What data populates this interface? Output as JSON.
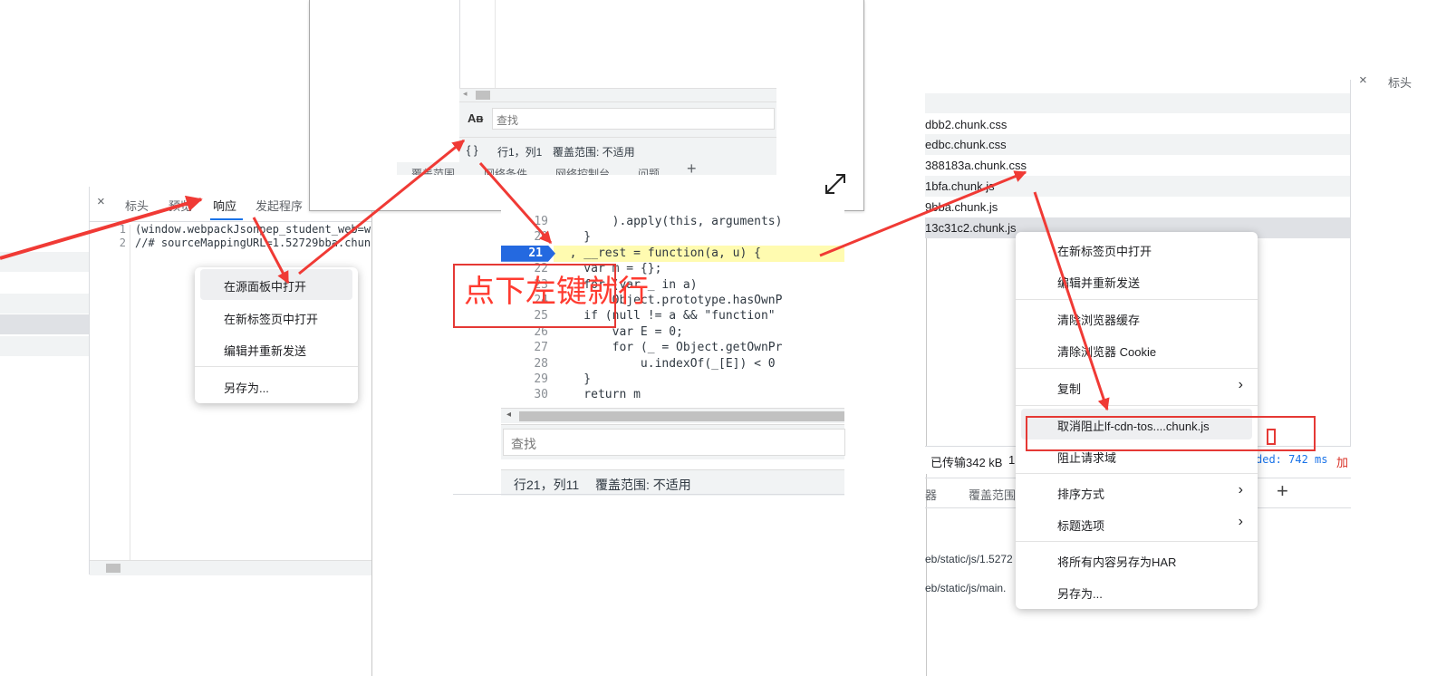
{
  "left_panel": {
    "tabs": [
      "标头",
      "预览",
      "响应",
      "发起程序"
    ],
    "close_icon": "×",
    "gutter": [
      "1",
      "2"
    ],
    "code_lines": [
      "(window.webpackJsonpep_student_web=wi",
      "//# sourceMappingURL=1.52729bba.chunk"
    ]
  },
  "context_menu_1": {
    "items": [
      "在源面板中打开",
      "在新标签页中打开",
      "编辑并重新发送",
      "另存为..."
    ]
  },
  "popup": {
    "find_icon": "Aᴃ",
    "find_placeholder": "查找",
    "format_icon": "{ }",
    "status_pos": "行1，列1",
    "status_coverage": "覆盖范围: 不适用",
    "bottom_tabs": [
      "覆盖范围",
      "网络条件",
      "网络控制台",
      "问题"
    ],
    "add_icon": "+"
  },
  "code_editor": {
    "lines": [
      {
        "num": "19",
        "text": "        ).apply(this, arguments)"
      },
      {
        "num": "20",
        "text": "    }"
      },
      {
        "num": "21",
        "text": "  , __rest = function(a, u) {"
      },
      {
        "num": "22",
        "text": "    var m = {};"
      },
      {
        "num": "23",
        "text": "    for (var _ in a)"
      },
      {
        "num": "24",
        "text": "        Object.prototype.hasOwnP"
      },
      {
        "num": "25",
        "text": "    if (null != a && \"function\""
      },
      {
        "num": "26",
        "text": "        var E = 0;"
      },
      {
        "num": "27",
        "text": "        for (_ = Object.getOwnPr"
      },
      {
        "num": "28",
        "text": "            u.indexOf(_[E]) < 0"
      },
      {
        "num": "29",
        "text": "    }"
      },
      {
        "num": "30",
        "text": "    return m"
      }
    ],
    "current_line": "21",
    "find_placeholder": "查找",
    "status_pos": "行21，列11",
    "status_coverage": "覆盖范围: 不适用"
  },
  "annotation": {
    "text": "点下左键就行",
    "color": "#ff3b30"
  },
  "right_panel": {
    "header_close": "×",
    "header_tab": "标头",
    "files": [
      "dbb2.chunk.css",
      "edbc.chunk.css",
      "388183a.chunk.css",
      "1bfa.chunk.js",
      "9bba.chunk.js",
      "13c31c2.chunk.js"
    ],
    "status_transfer": "已传输342 kB",
    "status_transfer_more": "1.",
    "status_loaded": "ded: 742 ms",
    "status_extra": "加",
    "tabs": [
      "器",
      "覆盖范围"
    ],
    "add_icon": "+",
    "lower_rows": [
      "eb/static/js/1.5272",
      "eb/static/js/main."
    ]
  },
  "context_menu_2": {
    "items": [
      "在新标签页中打开",
      "编辑并重新发送",
      "清除浏览器缓存",
      "清除浏览器 Cookie",
      "复制",
      "取消阻止lf-cdn-tos....chunk.js",
      "阻止请求域",
      "排序方式",
      "标题选项",
      "将所有内容另存为HAR",
      "另存为..."
    ],
    "submenu_icon": "›"
  },
  "colors": {
    "arrow": "#f03a35",
    "highlight_box": "#e53935",
    "exec_line": "#2469e0",
    "accent": "#1a73e8"
  }
}
